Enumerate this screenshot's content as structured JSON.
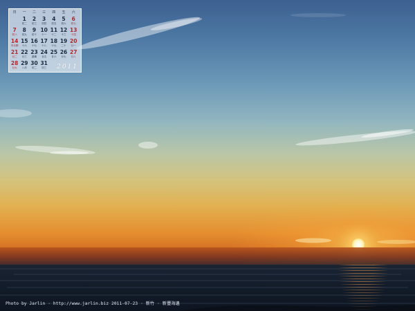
{
  "calendar": {
    "weekdays": [
      "日",
      "一",
      "二",
      "三",
      "四",
      "五",
      "六"
    ],
    "year": "2011",
    "weeks": [
      [
        null,
        null,
        null,
        null,
        null,
        {
          "day": "1",
          "sub": "初二"
        },
        {
          "day": "2",
          "sub": "初三"
        }
      ],
      [
        null,
        null,
        null,
        null,
        null,
        null,
        null
      ]
    ],
    "cells": [
      {
        "day": "",
        "sub": ""
      },
      {
        "day": "1",
        "sub": "初二"
      },
      {
        "day": "2",
        "sub": "初三"
      },
      {
        "day": "3",
        "sub": "初四"
      },
      {
        "day": "4",
        "sub": "初五"
      },
      {
        "day": "5",
        "sub": "初六"
      },
      {
        "day": "6",
        "sub": "初七"
      },
      {
        "day": "7",
        "sub": "初八"
      },
      {
        "day": "8",
        "sub": "初九"
      },
      {
        "day": "9",
        "sub": "初十"
      },
      {
        "day": "10",
        "sub": "十一"
      },
      {
        "day": "11",
        "sub": "十二"
      },
      {
        "day": "12",
        "sub": "十三"
      },
      {
        "day": "13",
        "sub": "十四"
      },
      {
        "day": "14",
        "sub": "中元節"
      },
      {
        "day": "15",
        "sub": "十六"
      },
      {
        "day": "16",
        "sub": "十七"
      },
      {
        "day": "17",
        "sub": "十八"
      },
      {
        "day": "18",
        "sub": "十九"
      },
      {
        "day": "19",
        "sub": "二十"
      },
      {
        "day": "20",
        "sub": "廿一"
      },
      {
        "day": "21",
        "sub": "廿二"
      },
      {
        "day": "22",
        "sub": "廿三"
      },
      {
        "day": "23",
        "sub": "處暑"
      },
      {
        "day": "24",
        "sub": "廿五"
      },
      {
        "day": "25",
        "sub": "廿六"
      },
      {
        "day": "26",
        "sub": "廿七"
      },
      {
        "day": "27",
        "sub": "廿八"
      },
      {
        "day": "28",
        "sub": "廿九"
      },
      {
        "day": "29",
        "sub": "八月"
      },
      {
        "day": "30",
        "sub": "初二"
      },
      {
        "day": "31",
        "sub": "初三"
      },
      {
        "day": "",
        "sub": ""
      },
      {
        "day": "",
        "sub": ""
      },
      {
        "day": "",
        "sub": ""
      }
    ]
  },
  "credit": {
    "text": "Photo by Jarlin · http://www.jarlin.biz  2011-07-23 · 新竹 · 新豐海邊"
  },
  "colors": {
    "sky_top": "#3d6090",
    "horizon_orange": "#e58e2f",
    "sun": "#fff6c8",
    "sea": "#141d2b",
    "weekend_red": "#b0262e"
  }
}
